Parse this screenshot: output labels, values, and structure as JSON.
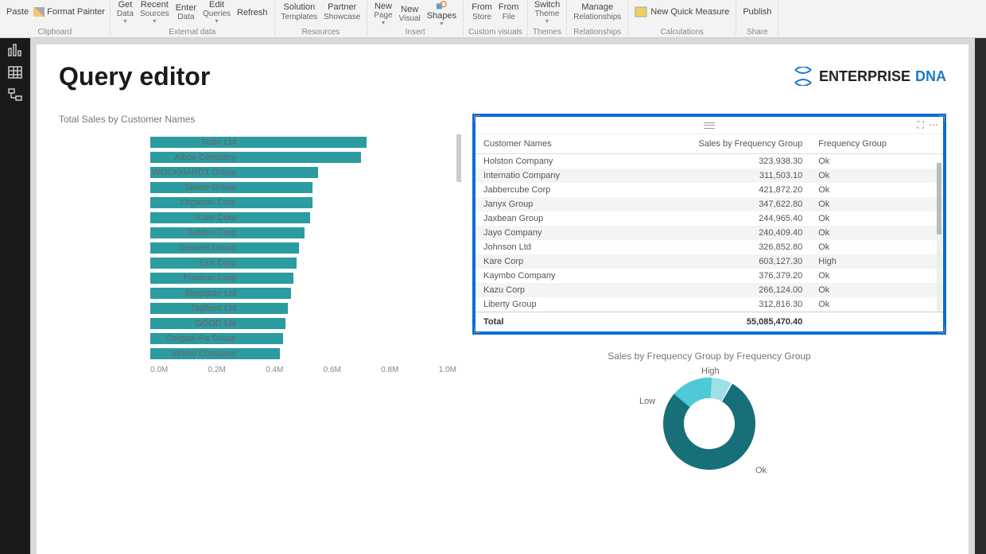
{
  "ribbon": {
    "paste": "Paste",
    "format_painter": "Format Painter",
    "clipboard": "Clipboard",
    "get_data": "Get",
    "get_data_sub": "Data",
    "recent": "Recent",
    "recent_sub": "Sources",
    "enter": "Enter",
    "enter_sub": "Data",
    "edit_queries": "Edit",
    "edit_queries_sub": "Queries",
    "refresh": "Refresh",
    "external": "External data",
    "solution": "Solution",
    "solution_sub": "Templates",
    "partner": "Partner",
    "partner_sub": "Showcase",
    "resources": "Resources",
    "new_page": "New",
    "new_page_sub": "Page",
    "new_visual": "New",
    "new_visual_sub": "Visual",
    "shapes": "Shapes",
    "insert": "Insert",
    "from_store": "From",
    "from_store_sub": "Store",
    "from_file": "From",
    "from_file_sub": "File",
    "custom": "Custom visuals",
    "switch": "Switch",
    "switch_sub": "Theme",
    "themes": "Themes",
    "manage": "Manage",
    "manage_sub": "Relationships",
    "relationships": "Relationships",
    "measure": "New Quick Measure",
    "calculations": "Calculations",
    "publish": "Publish",
    "share": "Share"
  },
  "page": {
    "title": "Query editor",
    "brand1": "ENTERPRISE",
    "brand2": "DNA"
  },
  "chart_data": [
    {
      "type": "bar",
      "title": "Total Sales by Customer Names",
      "xticks": [
        "0.0M",
        "0.2M",
        "0.4M",
        "0.6M",
        "0.8M",
        "1.0M"
      ],
      "categories": [
        "State Ltd",
        "Aibox Company",
        "WOCKHARDT Group",
        "Talane Group",
        "Organon Corp",
        "Kare Corp",
        "Golden Corp",
        "Deseret Group",
        "Eire Corp",
        "Pixoboo Corp",
        "Blogspan Ltd",
        "Tagfeed Ltd",
        "GOOD Ltd",
        "Colgate-Pa Group",
        "Vimbo Company"
      ],
      "values": [
        0.8,
        0.78,
        0.62,
        0.6,
        0.6,
        0.59,
        0.57,
        0.55,
        0.54,
        0.53,
        0.52,
        0.51,
        0.5,
        0.49,
        0.48
      ],
      "xmax": 1.0
    },
    {
      "type": "pie",
      "title": "Sales by Frequency Group by Frequency Group",
      "series": [
        {
          "name": "Ok",
          "value": 78
        },
        {
          "name": "Low",
          "value": 15
        },
        {
          "name": "High",
          "value": 7
        }
      ]
    }
  ],
  "table": {
    "headers": [
      "Customer Names",
      "Sales by Frequency Group",
      "Frequency Group"
    ],
    "rows": [
      [
        "Holston Company",
        "323,938.30",
        "Ok"
      ],
      [
        "Internatio Company",
        "311,503.10",
        "Ok"
      ],
      [
        "Jabbercube Corp",
        "421,872.20",
        "Ok"
      ],
      [
        "Janyx Group",
        "347,622.80",
        "Ok"
      ],
      [
        "Jaxbean Group",
        "244,965.40",
        "Ok"
      ],
      [
        "Jayo Company",
        "240,409.40",
        "Ok"
      ],
      [
        "Johnson Ltd",
        "326,852.80",
        "Ok"
      ],
      [
        "Kare Corp",
        "603,127.30",
        "High"
      ],
      [
        "Kaymbo Company",
        "376,379.20",
        "Ok"
      ],
      [
        "Kazu Corp",
        "266,124.00",
        "Ok"
      ],
      [
        "Liberty Group",
        "312,816.30",
        "Ok"
      ]
    ],
    "total_label": "Total",
    "total_value": "55,085,470.40"
  }
}
